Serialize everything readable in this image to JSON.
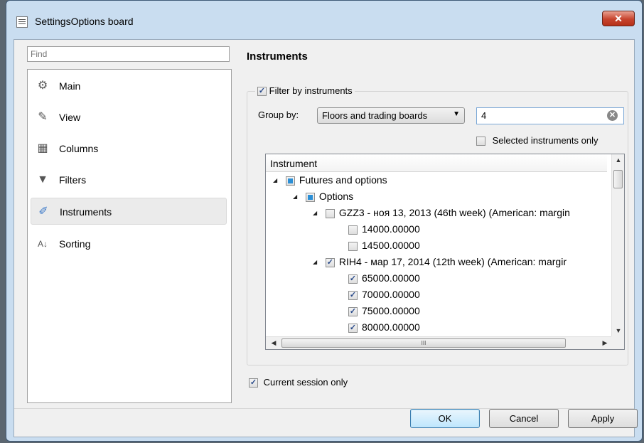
{
  "window": {
    "title": "SettingsOptions board",
    "close_glyph": "✕"
  },
  "search": {
    "placeholder": "Find"
  },
  "nav": {
    "items": [
      {
        "label": "Main",
        "icon": "gear-icon"
      },
      {
        "label": "View",
        "icon": "brush-icon"
      },
      {
        "label": "Columns",
        "icon": "columns-icon"
      },
      {
        "label": "Filters",
        "icon": "funnel-icon"
      },
      {
        "label": "Instruments",
        "icon": "instruments-icon",
        "selected": true
      },
      {
        "label": "Sorting",
        "icon": "sort-az-icon"
      }
    ]
  },
  "pane": {
    "title": "Instruments",
    "filter_by_instruments": {
      "label": "Filter by instruments",
      "checked": true
    },
    "group_by": {
      "label": "Group by:",
      "value": "Floors and trading boards"
    },
    "search_value": "4",
    "selected_only": {
      "label": "Selected instruments only",
      "checked": false
    },
    "tree": {
      "column_header": "Instrument",
      "rows": [
        {
          "label": "Futures and options",
          "level": 0,
          "state": "partial",
          "expanded": true
        },
        {
          "label": "Options",
          "level": 1,
          "state": "partial",
          "expanded": true
        },
        {
          "label": "GZZ3 - ноя 13, 2013 (46th week) (American: margin",
          "level": 2,
          "state": "unchecked",
          "expanded": true
        },
        {
          "label": "14000.00000",
          "level": 3,
          "state": "unchecked"
        },
        {
          "label": "14500.00000",
          "level": 3,
          "state": "unchecked"
        },
        {
          "label": "RIH4 - мар 17, 2014 (12th week) (American: margir",
          "level": 2,
          "state": "checked",
          "expanded": true
        },
        {
          "label": "65000.00000",
          "level": 3,
          "state": "checked"
        },
        {
          "label": "70000.00000",
          "level": 3,
          "state": "checked"
        },
        {
          "label": "75000.00000",
          "level": 3,
          "state": "checked"
        },
        {
          "label": "80000.00000",
          "level": 3,
          "state": "checked"
        }
      ]
    },
    "current_session_only": {
      "label": "Current session only",
      "checked": true
    }
  },
  "buttons": {
    "ok": "OK",
    "cancel": "Cancel",
    "apply": "Apply"
  },
  "glyphs": {
    "check": "✓",
    "expanded": "◢",
    "dropdown": "▼",
    "clear": "✕",
    "scroll_up": "▲",
    "scroll_down": "▼",
    "scroll_left": "◀",
    "scroll_right": "▶",
    "sort": "⌃",
    "grip": "III"
  }
}
